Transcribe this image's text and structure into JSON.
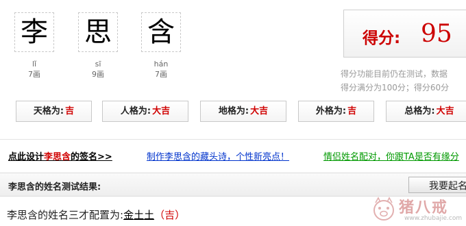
{
  "name_chars": [
    {
      "char": "李",
      "pinyin": "lǐ",
      "strokes": "7画"
    },
    {
      "char": "思",
      "pinyin": "sī",
      "strokes": "9画"
    },
    {
      "char": "含",
      "pinyin": "hán",
      "strokes": "7画"
    }
  ],
  "score": {
    "label": "得分:",
    "value": "95",
    "note_line1": "得分功能目前仍在测试，数据",
    "note_line2": "得分满分为100分；得分60分"
  },
  "grids": [
    {
      "label": "天格为:",
      "value": "吉"
    },
    {
      "label": "人格为:",
      "value": "大吉"
    },
    {
      "label": "地格为:",
      "value": "大吉"
    },
    {
      "label": "外格为:",
      "value": "吉"
    },
    {
      "label": "总格为:",
      "value": "大吉"
    }
  ],
  "links": {
    "design_prefix": "点此设计",
    "design_name": "李思含",
    "design_suffix": "的签名>>",
    "acrostic": "制作李思含的藏头诗，个性新亮点！",
    "match": "情侣姓名配对，你跟TA是否有缘分"
  },
  "results": {
    "title": "李思含的姓名测试结果:",
    "naming_button": "我要起名"
  },
  "sancai": {
    "prefix": "李思含的姓名三才配置为:",
    "elements": "金土土",
    "luck": "（吉）"
  },
  "watermark": {
    "text": "猪八戒",
    "url": "www.zhubajie.com"
  },
  "colors": {
    "accent_red": "#cc0000",
    "link_blue": "#0033cc",
    "link_green": "#009900"
  }
}
